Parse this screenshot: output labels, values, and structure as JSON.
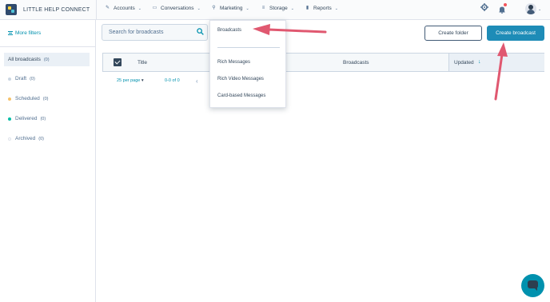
{
  "brand": {
    "name": "LITTLE HELP CONNECT"
  },
  "nav": {
    "items": [
      {
        "label": "Accounts",
        "icon": "wrench-icon"
      },
      {
        "label": "Conversations",
        "icon": "chat-icon"
      },
      {
        "label": "Marketing",
        "icon": "megaphone-icon"
      },
      {
        "label": "Storage",
        "icon": "storage-icon"
      },
      {
        "label": "Reports",
        "icon": "bar-chart-icon"
      }
    ],
    "notification_dot": true
  },
  "sidebar": {
    "more_filters": "More filters",
    "items": [
      {
        "label": "All broadcasts",
        "count": "(0)",
        "active": true
      },
      {
        "label": "Draft",
        "count": "(0)",
        "dot": "#cbd6e2"
      },
      {
        "label": "Scheduled",
        "count": "(0)",
        "dot": "#f5c26b"
      },
      {
        "label": "Delivered",
        "count": "(0)",
        "dot": "#00bda5"
      },
      {
        "label": "Archived",
        "count": "(0)",
        "dot": "#ffffff"
      }
    ]
  },
  "search": {
    "placeholder": "Search for broadcasts"
  },
  "buttons": {
    "create_folder": "Create folder",
    "create_broadcast": "Create broadcast"
  },
  "table": {
    "headers": {
      "title": "Title",
      "broadcasts": "Broadcasts",
      "updated": "Updated"
    },
    "pagination": {
      "per_page": "25 per page",
      "range": "0-0 of 0"
    }
  },
  "dropdown": {
    "items": [
      "Broadcasts",
      "Rich Messages",
      "Rich Video Messages",
      "Card-based Messages"
    ]
  },
  "colors": {
    "accent": "#1e8cb7",
    "arrow": "#e05870",
    "link": "#0091ae"
  }
}
